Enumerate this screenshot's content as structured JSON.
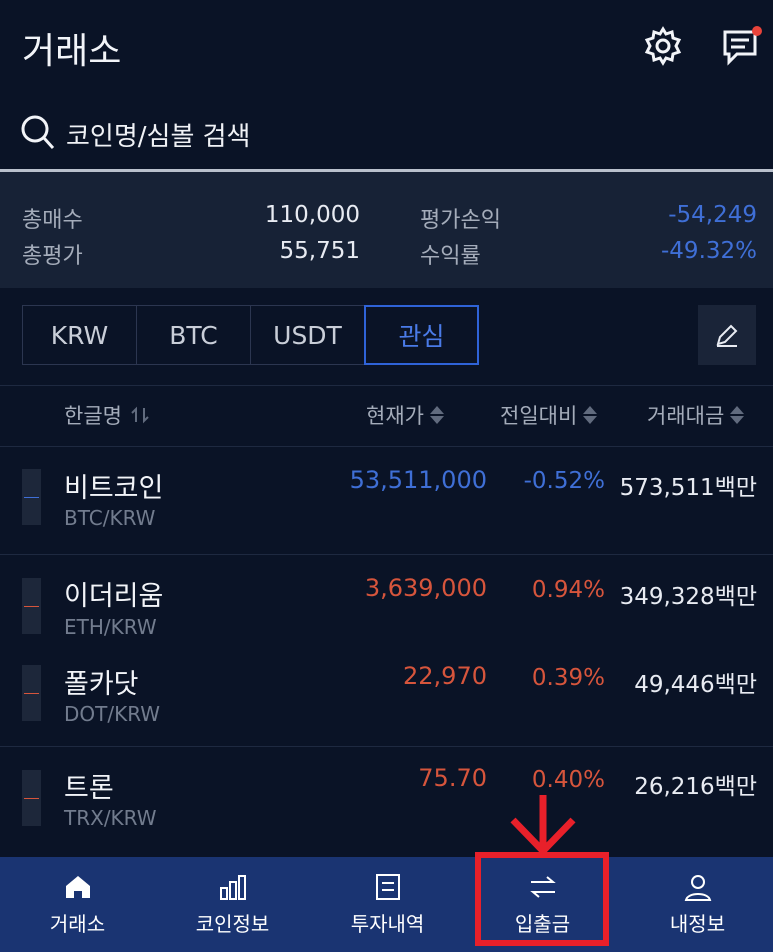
{
  "header": {
    "title": "거래소"
  },
  "search": {
    "placeholder": "코인명/심볼 검색"
  },
  "summary": {
    "total_buy_label": "총매수",
    "total_buy_value": "110,000",
    "total_eval_label": "총평가",
    "total_eval_value": "55,751",
    "pnl_label": "평가손익",
    "pnl_value": "-54,249",
    "yield_label": "수익률",
    "yield_value": "-49.32%"
  },
  "tabs": [
    "KRW",
    "BTC",
    "USDT",
    "관심"
  ],
  "active_tab": "관심",
  "columns": {
    "name": "한글명",
    "price": "현재가",
    "change": "전일대비",
    "volume": "거래대금"
  },
  "coins": [
    {
      "name": "비트코인",
      "symbol": "BTC/KRW",
      "price": "53,511,000",
      "change": "-0.52%",
      "volume": "573,511백만",
      "trend": "down"
    },
    {
      "name": "이더리움",
      "symbol": "ETH/KRW",
      "price": "3,639,000",
      "change": "0.94%",
      "volume": "349,328백만",
      "trend": "up"
    },
    {
      "name": "폴카닷",
      "symbol": "DOT/KRW",
      "price": "22,970",
      "change": "0.39%",
      "volume": "49,446백만",
      "trend": "up"
    },
    {
      "name": "트론",
      "symbol": "TRX/KRW",
      "price": "75.70",
      "change": "0.40%",
      "volume": "26,216백만",
      "trend": "up"
    }
  ],
  "nav": [
    {
      "label": "거래소",
      "icon": "home-icon"
    },
    {
      "label": "코인정보",
      "icon": "bar-chart-icon"
    },
    {
      "label": "투자내역",
      "icon": "document-icon"
    },
    {
      "label": "입출금",
      "icon": "transfer-icon"
    },
    {
      "label": "내정보",
      "icon": "user-icon"
    }
  ],
  "colors": {
    "background": "#0a1326",
    "nav": "#1a3472",
    "rise": "#d6553c",
    "fall": "#3f6fd6",
    "highlight": "#e8202a"
  }
}
